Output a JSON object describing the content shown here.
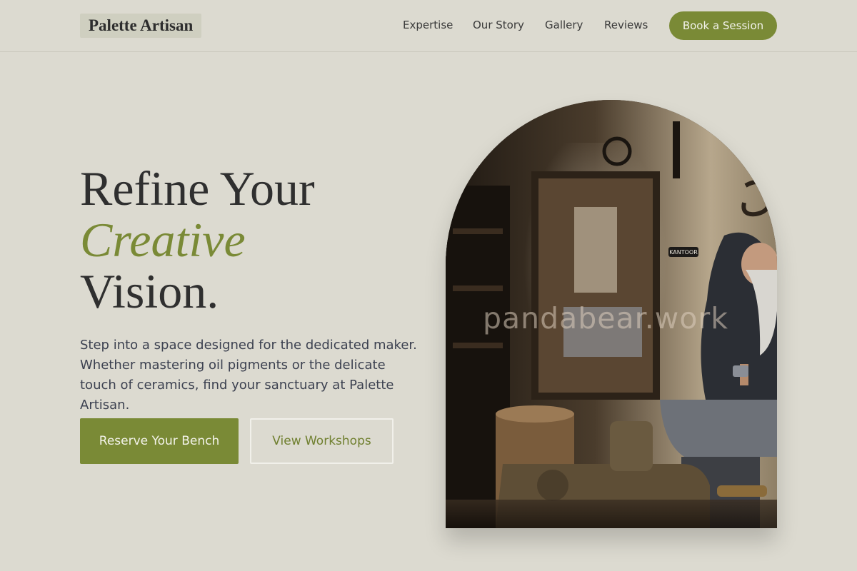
{
  "brand": {
    "name": "Palette Artisan"
  },
  "nav": {
    "links": [
      "Expertise",
      "Our Story",
      "Gallery",
      "Reviews"
    ],
    "cta": "Book a Session"
  },
  "hero": {
    "headline_line1": "Refine Your",
    "headline_em": "Creative",
    "headline_line3": "Vision.",
    "lede": "Step into a space designed for the dedicated maker. Whether mastering oil pigments or the delicate touch of ceramics, find your sanctuary at Palette Artisan.",
    "primary_cta": "Reserve Your Bench",
    "secondary_cta": "View Workshops",
    "image_watermark": "pandabear.work",
    "shop_sign": "KANTOOR"
  },
  "colors": {
    "background": "#dcdad0",
    "accent": "#7a8a36",
    "text": "#2f2f2f"
  }
}
